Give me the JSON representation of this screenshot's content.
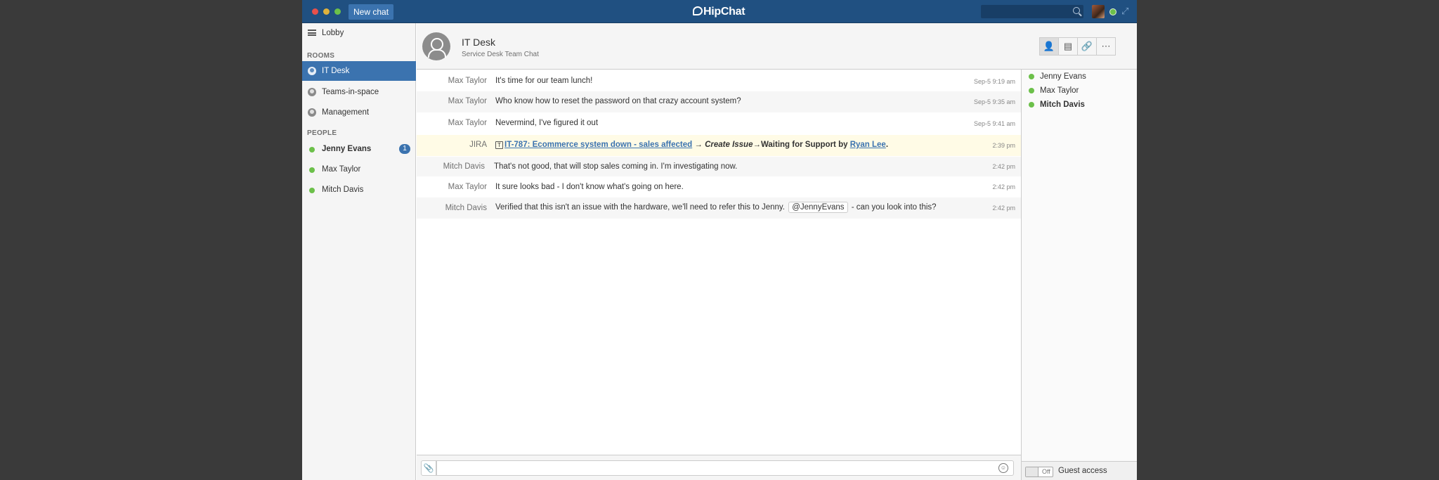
{
  "window": {
    "new_chat_label": "New chat",
    "logo_text": "HipChat",
    "search_placeholder": ""
  },
  "sidebar": {
    "lobby_label": "Lobby",
    "rooms_header": "ROOMS",
    "rooms": [
      {
        "label": "IT Desk",
        "active": true
      },
      {
        "label": "Teams-in-space",
        "active": false
      },
      {
        "label": "Management",
        "active": false
      }
    ],
    "people_header": "PEOPLE",
    "people": [
      {
        "label": "Jenny Evans",
        "unread": "1",
        "bold": true
      },
      {
        "label": "Max Taylor",
        "unread": "",
        "bold": false
      },
      {
        "label": "Mitch Davis",
        "unread": "",
        "bold": false
      }
    ]
  },
  "room": {
    "title": "IT Desk",
    "topic": "Service Desk Team Chat",
    "header_buttons": [
      "person-icon",
      "file-icon",
      "link-icon",
      "more-icon"
    ]
  },
  "messages": [
    {
      "from": "Max Taylor",
      "text": "It's time for our team lunch!",
      "time": "Sep-5 9:19 am"
    },
    {
      "from": "Max Taylor",
      "text": "Who know how to reset the password on that crazy account system?",
      "time": "Sep-5 9:35 am"
    },
    {
      "from": "Max Taylor",
      "text": "Nevermind, I've figured it out",
      "time": "Sep-5 9:41 am"
    },
    {
      "from": "JIRA",
      "issue_link": "IT-787: Ecommerce system down - sales affected",
      "arrow1": " →",
      "action": "Create Issue",
      "arrow2": "→",
      "status": "Waiting for Support by ",
      "assignee": "Ryan Lee",
      "end": ".",
      "time": "2:39 pm"
    },
    {
      "from": "Mitch Davis",
      "text": "That's not good, that will stop sales coming in. I'm investigating now.",
      "time": "2:42 pm"
    },
    {
      "from": "Max Taylor",
      "text": "It sure looks bad - I don't know what's going on here.",
      "time": "2:42 pm"
    },
    {
      "from": "Mitch Davis",
      "text_before": "Verified that this isn't an issue with the hardware, we'll need to refer this to Jenny.",
      "mention": "@JennyEvans",
      "text_after": "- can you look into this?",
      "time": "2:42 pm"
    }
  ],
  "composer": {
    "placeholder": "",
    "value": ""
  },
  "roster": {
    "members": [
      {
        "label": "Jenny Evans",
        "bold": false
      },
      {
        "label": "Max Taylor",
        "bold": false
      },
      {
        "label": "Mitch Davis",
        "bold": true
      }
    ],
    "guest_toggle_state": "Off",
    "guest_label": "Guest access"
  },
  "colors": {
    "topbar": "#205081",
    "accent": "#3b73af",
    "online": "#6cc04a",
    "jira_highlight": "#fffbe6"
  }
}
